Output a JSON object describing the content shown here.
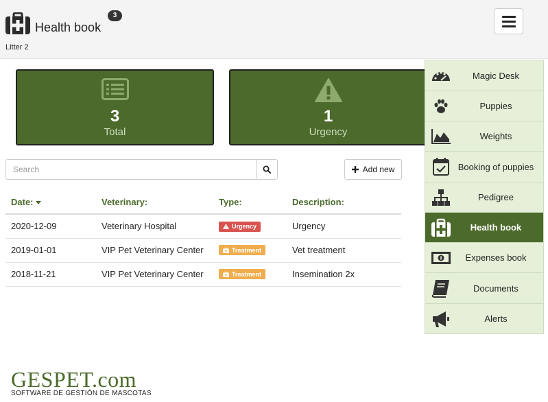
{
  "header": {
    "title": "Health book",
    "badge_count": "3",
    "subtitle": "Litter 2"
  },
  "stats": {
    "total": {
      "value": "3",
      "label": "Total",
      "icon": "list-icon"
    },
    "urgency": {
      "value": "1",
      "label": "Urgency",
      "icon": "warning-triangle-icon"
    }
  },
  "search": {
    "placeholder": "Search"
  },
  "toolbar": {
    "add_label": "Add new"
  },
  "table": {
    "columns": [
      "Date:",
      "Veterinary:",
      "Type:",
      "Description:"
    ],
    "sorted_column": "Date:",
    "rows": [
      {
        "date": "2020-12-09",
        "veterinary": "Veterinary Hospital",
        "type": "Urgency",
        "description": "Urgency"
      },
      {
        "date": "2019-01-01",
        "veterinary": "VIP Pet Veterinary Center",
        "type": "Treatment",
        "description": "Vet treatment"
      },
      {
        "date": "2018-11-21",
        "veterinary": "VIP Pet Veterinary Center",
        "type": "Treatment",
        "description": "Insemination 2x"
      }
    ]
  },
  "sidebar": {
    "items": [
      {
        "label": "Magic Desk",
        "icon": "dashboard-icon"
      },
      {
        "label": "Puppies",
        "icon": "paw-icon"
      },
      {
        "label": "Weights",
        "icon": "area-chart-icon"
      },
      {
        "label": "Booking of puppies",
        "icon": "calendar-check-icon"
      },
      {
        "label": "Pedigree",
        "icon": "sitemap-icon"
      },
      {
        "label": "Health book",
        "icon": "medkit-icon",
        "active": true
      },
      {
        "label": "Expenses book",
        "icon": "money-icon"
      },
      {
        "label": "Documents",
        "icon": "book-icon"
      },
      {
        "label": "Alerts",
        "icon": "megaphone-icon"
      }
    ]
  },
  "logo": {
    "main": "GESPET.com",
    "sub": "SOFTWARE DE GESTIÓN DE MASCOTAS"
  },
  "colors": {
    "brand_green": "#4b6a2b",
    "sidebar_bg": "#e6f0d8",
    "urgency_red": "#d9534f",
    "treatment_orange": "#f0ad4e"
  }
}
